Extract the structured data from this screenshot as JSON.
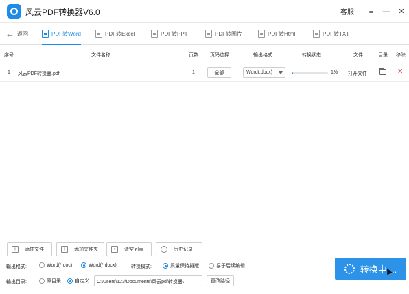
{
  "app": {
    "title": "风云PDF转换器V6.0"
  },
  "titlebar": {
    "service": "客服",
    "menu_icon": "≡",
    "minimize_icon": "—",
    "close_icon": "✕"
  },
  "nav": {
    "back_label": "返回",
    "tabs": [
      {
        "label": "PDF转Word",
        "active": true
      },
      {
        "label": "PDF转Excel",
        "active": false
      },
      {
        "label": "PDF转PPT",
        "active": false
      },
      {
        "label": "PDF转图片",
        "active": false
      },
      {
        "label": "PDF转Html",
        "active": false
      },
      {
        "label": "PDF转TXT",
        "active": false
      }
    ]
  },
  "table": {
    "headers": [
      "序号",
      "文件名称",
      "页数",
      "页码选择",
      "输出格式",
      "转换状态",
      "文件",
      "目录",
      "移除"
    ],
    "rows": [
      {
        "index": "1",
        "filename": "风云PDF转换器.pdf",
        "pages": "1",
        "range": "全部",
        "format": "Word(.docx)",
        "progress": 1,
        "progress_text": "1%",
        "open_label": "打开文件"
      }
    ]
  },
  "actions": {
    "add_file": "添加文件",
    "add_folder": "添加文件夹",
    "clear_list": "清空列表",
    "history": "历史记录"
  },
  "options": {
    "output_format_label": "输出格式:",
    "format_doc": "Word(*.doc)",
    "format_docx": "Word(*.docx)",
    "selected_format": "docx",
    "mode_label": "转换模式:",
    "mode_layout": "质量保持排版",
    "mode_edit": "易于后续编辑",
    "selected_mode": "layout",
    "output_dir_label": "输出目录:",
    "dir_original": "原目录",
    "dir_custom": "自定义",
    "selected_dir": "custom",
    "path_value": "C:\\Users\\123\\Documents\\风云pdf转换器\\",
    "change_path": "更改路径"
  },
  "convert": {
    "label": "转换中 ..."
  },
  "colors": {
    "accent": "#1e8be6",
    "remove": "#e23a3a"
  }
}
